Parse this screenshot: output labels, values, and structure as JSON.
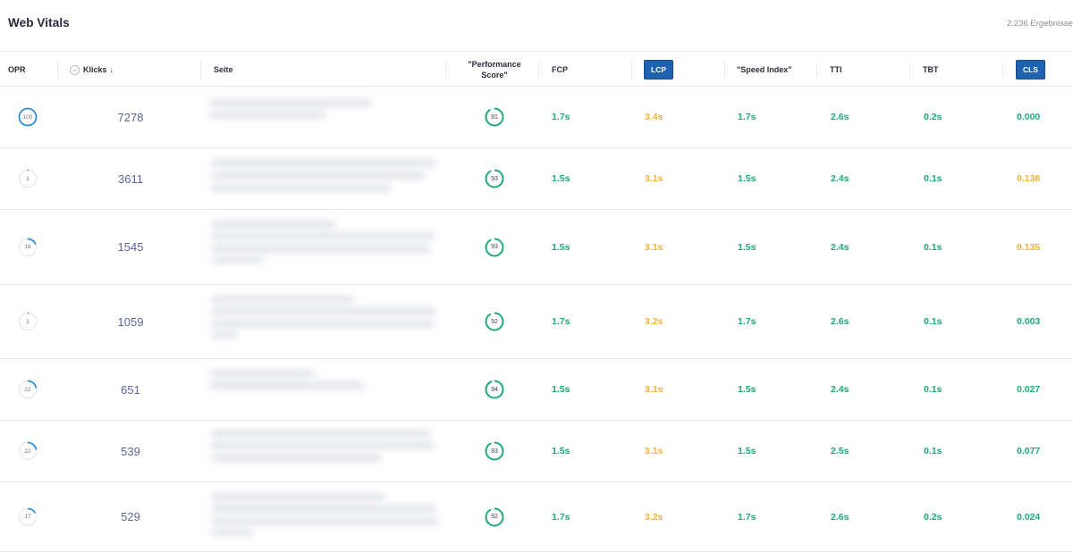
{
  "header": {
    "title": "Web Vitals",
    "results": "2.236 Ergebnisse"
  },
  "columns": {
    "opr": "OPR",
    "klicks": "Klicks",
    "sort_arrow": "↓",
    "seite": "Seite",
    "performance_line1": "\"Performance",
    "performance_line2": "Score\"",
    "fcp": "FCP",
    "lcp": "LCP",
    "speed_index": "\"Speed Index\"",
    "tti": "TTI",
    "tbt": "TBT",
    "cls": "CLS"
  },
  "colors": {
    "good": "#21a876",
    "needs_improvement": "#f0b13a",
    "opr_ring": "#2a8fd8",
    "badge": "#1f63b0"
  },
  "rows": [
    {
      "opr": "100",
      "opr_fraction": 1.0,
      "klicks": "7278",
      "score": "91",
      "fcp": "1.7s",
      "lcp": "3.4s",
      "si": "1.7s",
      "tti": "2.6s",
      "tbt": "0.2s",
      "cls": "0.000",
      "cls_status": "good"
    },
    {
      "opr": "1",
      "opr_fraction": 0.02,
      "klicks": "3611",
      "score": "93",
      "fcp": "1.5s",
      "lcp": "3.1s",
      "si": "1.5s",
      "tti": "2.4s",
      "tbt": "0.1s",
      "cls": "0.138",
      "cls_status": "needs_improvement"
    },
    {
      "opr": "19",
      "opr_fraction": 0.19,
      "klicks": "1545",
      "score": "93",
      "fcp": "1.5s",
      "lcp": "3.1s",
      "si": "1.5s",
      "tti": "2.4s",
      "tbt": "0.1s",
      "cls": "0.135",
      "cls_status": "needs_improvement"
    },
    {
      "opr": "1",
      "opr_fraction": 0.02,
      "klicks": "1059",
      "score": "92",
      "fcp": "1.7s",
      "lcp": "3.2s",
      "si": "1.7s",
      "tti": "2.6s",
      "tbt": "0.1s",
      "cls": "0.003",
      "cls_status": "good"
    },
    {
      "opr": "22",
      "opr_fraction": 0.22,
      "klicks": "651",
      "score": "94",
      "fcp": "1.5s",
      "lcp": "3.1s",
      "si": "1.5s",
      "tti": "2.4s",
      "tbt": "0.1s",
      "cls": "0.027",
      "cls_status": "good"
    },
    {
      "opr": "22",
      "opr_fraction": 0.22,
      "klicks": "539",
      "score": "93",
      "fcp": "1.5s",
      "lcp": "3.1s",
      "si": "1.5s",
      "tti": "2.5s",
      "tbt": "0.1s",
      "cls": "0.077",
      "cls_status": "good"
    },
    {
      "opr": "17",
      "opr_fraction": 0.17,
      "klicks": "529",
      "score": "92",
      "fcp": "1.7s",
      "lcp": "3.2s",
      "si": "1.7s",
      "tti": "2.6s",
      "tbt": "0.2s",
      "cls": "0.024",
      "cls_status": "good"
    }
  ]
}
